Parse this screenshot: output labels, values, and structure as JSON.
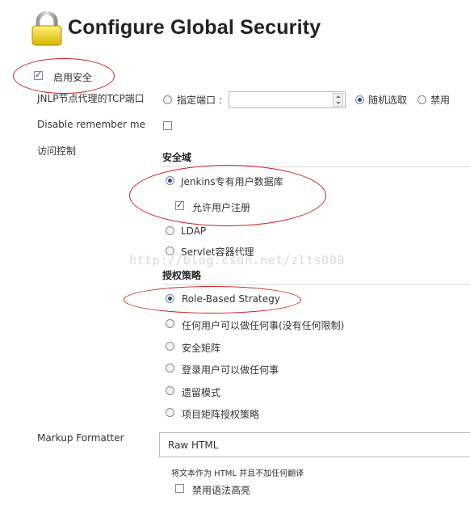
{
  "header": {
    "title": "Configure Global Security",
    "icon": "lock-icon"
  },
  "enable_security": {
    "label": "启用安全",
    "checked": true
  },
  "jnlp": {
    "label": "JNLP节点代理的TCP端口",
    "options": [
      {
        "label": "指定端口 :",
        "selected": false
      },
      {
        "label": "随机选取",
        "selected": true
      },
      {
        "label": "禁用",
        "selected": false
      }
    ],
    "port_value": ""
  },
  "remember_me": {
    "label": "Disable remember me",
    "checked": false
  },
  "access_control": {
    "label": "访问控制",
    "security_realm": {
      "heading": "安全域",
      "options": [
        {
          "label": "Jenkins专有用户数据库",
          "selected": true
        },
        {
          "label": "LDAP",
          "selected": false
        },
        {
          "label": "Servlet容器代理",
          "selected": false
        }
      ],
      "allow_signup": {
        "label": "允许用户注册",
        "checked": true
      }
    },
    "authorization": {
      "heading": "授权策略",
      "options": [
        {
          "label": "Role-Based Strategy",
          "selected": true
        },
        {
          "label": "任何用户可以做任何事(没有任何限制)",
          "selected": false
        },
        {
          "label": "安全矩阵",
          "selected": false
        },
        {
          "label": "登录用户可以做任何事",
          "selected": false
        },
        {
          "label": "遗留模式",
          "selected": false
        },
        {
          "label": "项目矩阵授权策略",
          "selected": false
        }
      ]
    }
  },
  "markup_formatter": {
    "label": "Markup Formatter",
    "value": "Raw HTML",
    "hint": "将文本作为 HTML 并且不加任何翻译",
    "disable_highlight": {
      "label": "禁用语法高亮",
      "checked": false
    }
  },
  "watermark": "http://blog.csdn.net/zlts000",
  "colors": {
    "annotation": "#d21d1d",
    "radio_selected": "#1e4f9c"
  }
}
